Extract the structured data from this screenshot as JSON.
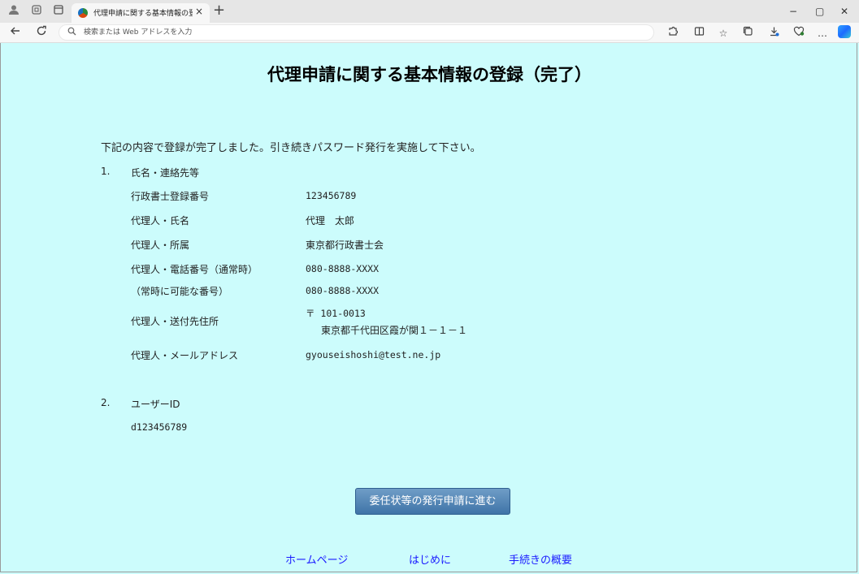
{
  "browser": {
    "tab_title": "代理申請に関する基本情報の登録",
    "tab_close": "×",
    "new_tab": "+",
    "address_placeholder": "検索または Web アドレスを入力",
    "win_min": "−",
    "win_max": "▢",
    "win_close": "✕",
    "more": "…"
  },
  "page": {
    "title": "代理申請に関する基本情報の登録（完了）",
    "intro": "下記の内容で登録が完了しました。引き続きパスワード発行を実施して下さい。",
    "section1": {
      "num": "1.",
      "title": "氏名・連絡先等",
      "rows": [
        {
          "label": "行政書士登録番号",
          "value": "123456789"
        },
        {
          "label": "代理人・氏名",
          "value": "代理　太郎"
        },
        {
          "label": "代理人・所属",
          "value": "東京都行政書士会"
        },
        {
          "label": "代理人・電話番号（通常時）",
          "value": "080-8888-XXXX"
        },
        {
          "label": "（常時に可能な番号）",
          "value": "080-8888-XXXX"
        },
        {
          "label": "代理人・送付先住所",
          "value": "〒 101-0013",
          "value2": "東京都千代田区霞が関１－１－１"
        },
        {
          "label": "代理人・メールアドレス",
          "value": "gyouseishoshi@test.ne.jp"
        }
      ]
    },
    "section2": {
      "num": "2.",
      "title": "ユーザーID",
      "value": "d123456789"
    },
    "button": "委任状等の発行申請に進む",
    "footer_links": [
      "ホームページ",
      "はじめに",
      "手続きの概要"
    ]
  }
}
